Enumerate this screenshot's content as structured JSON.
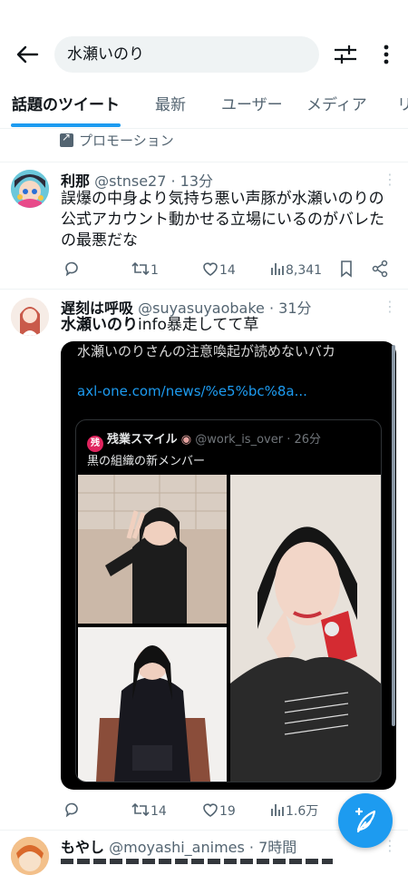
{
  "header": {
    "search_value": "水瀬いのり"
  },
  "tabs": [
    "話題のツイート",
    "最新",
    "ユーザー",
    "メディア",
    "リ"
  ],
  "promotion_label": "プロモーション",
  "tweets": [
    {
      "name": "利那",
      "handle": "@stnse27 · 13分",
      "text_lines": [
        "誤爆の中身より気持ち悪い声豚が水瀬いのりの",
        "公式アカウント動かせる立場にいるのがバレた",
        "の最悪だな"
      ],
      "retweets": "1",
      "likes": "14",
      "views": "8,341"
    },
    {
      "name": "遅刻は呼吸",
      "handle": "@suyasuyaobake · 31分",
      "text_bold": "水瀬いのり",
      "text_rest": "info暴走してて草",
      "quote": {
        "text": "水瀬いのりさんの注意喚起が読めないバカ",
        "link": "axl-one.com/news/%e5%bc%8a...",
        "inner_badge": "残",
        "inner_name": "残業スマイル",
        "inner_handle": "@work_is_over · 26分",
        "inner_text": "黒の組織の新メンバー"
      },
      "retweets": "14",
      "likes": "19",
      "views": "1.6万"
    },
    {
      "name": "もやし",
      "handle": "@moyashi_animes · 7時間"
    }
  ],
  "icons": {
    "back": "arrow-left-icon",
    "filter": "sliders-icon",
    "more": "more-vertical-icon",
    "compose": "compose-feather-icon"
  },
  "colors": {
    "accent": "#1d9bf0",
    "text": "#0f1419",
    "secondary": "#536471"
  }
}
